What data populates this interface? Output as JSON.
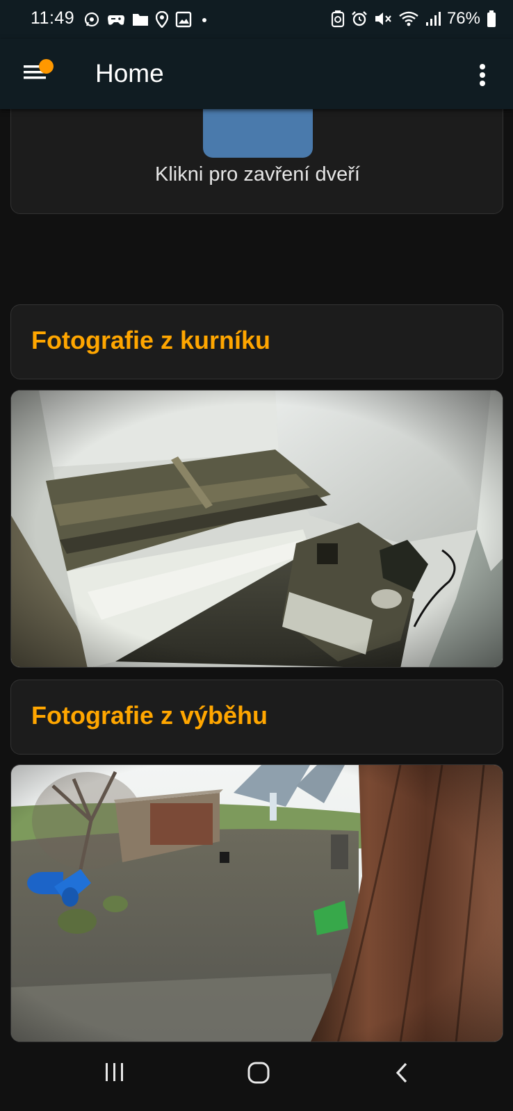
{
  "status_bar": {
    "time": "11:49",
    "battery_percent": "76%",
    "left_icons": [
      "whatsapp-icon",
      "gamepad-icon",
      "folder-icon",
      "location-icon",
      "image-icon",
      "dot-icon"
    ],
    "right_icons": [
      "recycle-icon",
      "alarm-icon",
      "mute-icon",
      "wifi-icon",
      "signal-icon",
      "battery-icon"
    ]
  },
  "app_bar": {
    "title": "Home",
    "menu_icon": "menu-icon",
    "more_icon": "more-vert-icon",
    "badge_color": "#ff9800"
  },
  "door_card": {
    "button_color": "#4a7aac",
    "label": "Klikni pro zavření dveří"
  },
  "sections": [
    {
      "heading": "Fotografie z kurníku",
      "photo": "coop-interior-photo"
    },
    {
      "heading": "Fotografie z výběhu",
      "photo": "chicken-run-photo"
    }
  ],
  "colors": {
    "accent": "#ffa600",
    "background": "#111111",
    "card": "#1c1c1c",
    "header": "#101c22"
  },
  "nav_bar": {
    "icons": [
      "recent-apps-icon",
      "home-icon",
      "back-icon"
    ]
  }
}
